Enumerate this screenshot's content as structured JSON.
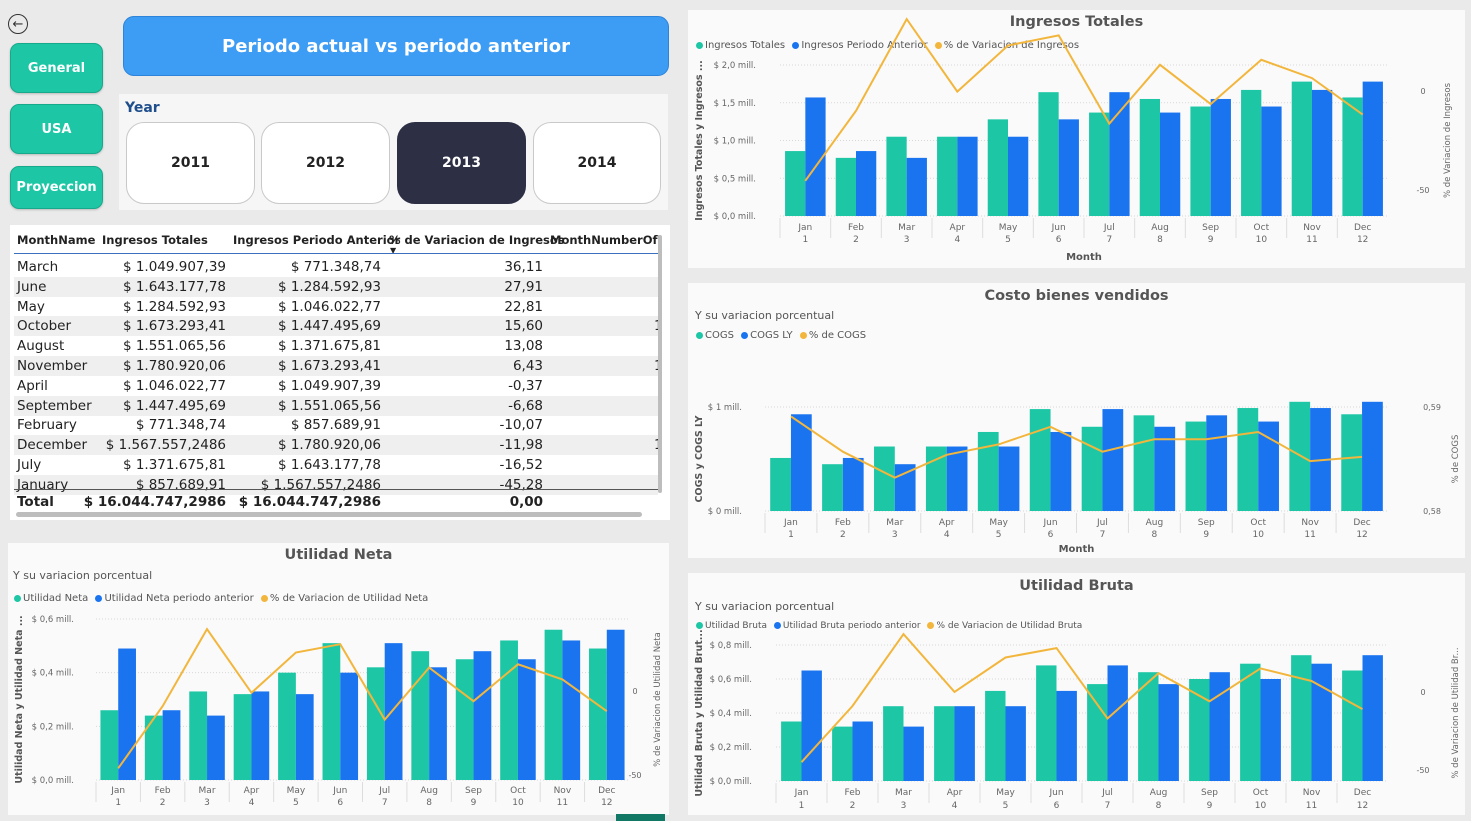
{
  "nav": {
    "back_icon": "arrow-left-circle-icon",
    "general": "General",
    "usa": "USA",
    "proyeccion": "Proyeccion"
  },
  "banner": {
    "title": "Periodo actual vs periodo anterior"
  },
  "year_slicer": {
    "title": "Year",
    "options": [
      "2011",
      "2012",
      "2013",
      "2014"
    ],
    "selected": "2013"
  },
  "table": {
    "headers": [
      "MonthName",
      "Ingresos Totales",
      "Ingresos Periodo Anterior",
      "% de Variacion de Ingresos",
      "MonthNumberOfYe"
    ],
    "rows": [
      [
        "March",
        "$ 1.049.907,39",
        "$ 771.348,74",
        "36,11",
        ""
      ],
      [
        "June",
        "$ 1.643.177,78",
        "$ 1.284.592,93",
        "27,91",
        ""
      ],
      [
        "May",
        "$ 1.284.592,93",
        "$ 1.046.022,77",
        "22,81",
        ""
      ],
      [
        "October",
        "$ 1.673.293,41",
        "$ 1.447.495,69",
        "15,60",
        "1"
      ],
      [
        "August",
        "$ 1.551.065,56",
        "$ 1.371.675,81",
        "13,08",
        ""
      ],
      [
        "November",
        "$ 1.780.920,06",
        "$ 1.673.293,41",
        "6,43",
        "1"
      ],
      [
        "April",
        "$ 1.046.022,77",
        "$ 1.049.907,39",
        "-0,37",
        ""
      ],
      [
        "September",
        "$ 1.447.495,69",
        "$ 1.551.065,56",
        "-6,68",
        ""
      ],
      [
        "February",
        "$ 771.348,74",
        "$ 857.689,91",
        "-10,07",
        ""
      ],
      [
        "December",
        "$ 1.567.557,2486",
        "$ 1.780.920,06",
        "-11,98",
        "1"
      ],
      [
        "July",
        "$ 1.371.675,81",
        "$ 1.643.177,78",
        "-16,52",
        ""
      ],
      [
        "January",
        "$ 857.689,91",
        "$ 1.567.557,2486",
        "-45,28",
        ""
      ]
    ],
    "total": [
      "Total",
      "$ 16.044.747,2986",
      "$ 16.044.747,2986",
      "0,00",
      ""
    ]
  },
  "colors": {
    "current": "#1dc7a6",
    "previous": "#1a74f0",
    "variation": "#f2b63c"
  },
  "chart_data": [
    {
      "id": "ingresos",
      "type": "bar",
      "title": "Ingresos Totales",
      "subtitle": "",
      "legend": [
        "Ingresos Totales",
        "Ingresos Periodo Anterior",
        "% de Variacion de Ingresos"
      ],
      "categories": [
        "Jan",
        "Feb",
        "Mar",
        "Apr",
        "May",
        "Jun",
        "Jul",
        "Aug",
        "Sep",
        "Oct",
        "Nov",
        "Dec"
      ],
      "category_numbers": [
        "1",
        "2",
        "3",
        "4",
        "5",
        "6",
        "7",
        "8",
        "9",
        "10",
        "11",
        "12"
      ],
      "xlabel": "Month",
      "ylabel": "Ingresos Totales y Ingresos ...",
      "y2label": "% de Variacion de Ingresos",
      "yticks": [
        "$ 0,0 mill.",
        "$ 0,5 mill.",
        "$ 1,0 mill.",
        "$ 1,5 mill.",
        "$ 2,0 mill."
      ],
      "ylim": [
        0,
        2.0
      ],
      "y2ticks": [
        "-50",
        "0"
      ],
      "y2tick_values": [
        -50,
        0
      ],
      "y2lim": [
        -63,
        13
      ],
      "series": [
        {
          "name": "Ingresos Totales",
          "values": [
            0.86,
            0.77,
            1.05,
            1.05,
            1.28,
            1.64,
            1.37,
            1.55,
            1.45,
            1.67,
            1.78,
            1.57
          ]
        },
        {
          "name": "Ingresos Periodo Anterior",
          "values": [
            1.57,
            0.86,
            0.77,
            1.05,
            1.05,
            1.28,
            1.64,
            1.37,
            1.55,
            1.45,
            1.67,
            1.78
          ]
        },
        {
          "name": "% de Variacion de Ingresos",
          "values": [
            -45.28,
            -10.07,
            36.11,
            -0.37,
            22.81,
            27.91,
            -16.52,
            13.08,
            -6.68,
            15.6,
            6.43,
            -11.98
          ]
        }
      ]
    },
    {
      "id": "cogs",
      "type": "bar",
      "title": "Costo bienes vendidos",
      "subtitle": "Y su variacion porcentual",
      "legend": [
        "COGS",
        "COGS LY",
        "% de COGS"
      ],
      "categories": [
        "Jan",
        "Feb",
        "Mar",
        "Apr",
        "May",
        "Jun",
        "Jul",
        "Aug",
        "Sep",
        "Oct",
        "Nov",
        "Dec"
      ],
      "category_numbers": [
        "1",
        "2",
        "3",
        "4",
        "5",
        "6",
        "7",
        "8",
        "9",
        "10",
        "11",
        "12"
      ],
      "xlabel": "Month",
      "ylabel": "COGS y COGS LY",
      "y2label": "% de COGS",
      "yticks": [
        "$ 0 mill.",
        "$ 1 mill."
      ],
      "ylim": [
        0,
        1.0
      ],
      "y2ticks": [
        "0,58",
        "0,59"
      ],
      "y2tick_values": [
        0.58,
        0.59
      ],
      "y2lim": [
        0.58,
        0.59
      ],
      "series": [
        {
          "name": "COGS",
          "values": [
            0.51,
            0.45,
            0.62,
            0.62,
            0.76,
            0.98,
            0.81,
            0.92,
            0.86,
            0.99,
            1.05,
            0.93
          ]
        },
        {
          "name": "COGS LY",
          "values": [
            0.93,
            0.51,
            0.45,
            0.62,
            0.62,
            0.76,
            0.98,
            0.81,
            0.92,
            0.86,
            0.99,
            1.05
          ]
        },
        {
          "name": "% de COGS",
          "values": [
            0.5891,
            0.5857,
            0.5832,
            0.5854,
            0.5864,
            0.5881,
            0.5857,
            0.5869,
            0.5869,
            0.5876,
            0.5848,
            0.5852
          ]
        }
      ]
    },
    {
      "id": "utilidad_neta",
      "type": "bar",
      "title": "Utilidad Neta",
      "subtitle": "Y su variacion porcentual",
      "legend": [
        "Utilidad Neta",
        "Utilidad Neta periodo anterior",
        "% de Variacion de Utilidad Neta"
      ],
      "categories": [
        "Jan",
        "Feb",
        "Mar",
        "Apr",
        "May",
        "Jun",
        "Jul",
        "Aug",
        "Sep",
        "Oct",
        "Nov",
        "Dec"
      ],
      "category_numbers": [
        "1",
        "2",
        "3",
        "4",
        "5",
        "6",
        "7",
        "8",
        "9",
        "10",
        "11",
        "12"
      ],
      "xlabel": "",
      "ylabel": "Utilidad Neta y Utilidad Neta ...",
      "y2label": "% de Variacion de Utilidad Neta",
      "yticks": [
        "$ 0,0 mill.",
        "$ 0,2 mill.",
        "$ 0,4 mill.",
        "$ 0,6 mill."
      ],
      "ylim": [
        0,
        0.6
      ],
      "y2ticks": [
        "-50",
        "0"
      ],
      "y2tick_values": [
        -50,
        0
      ],
      "y2lim": [
        -53,
        43
      ],
      "series": [
        {
          "name": "Utilidad Neta",
          "values": [
            0.26,
            0.24,
            0.33,
            0.32,
            0.4,
            0.51,
            0.42,
            0.48,
            0.45,
            0.52,
            0.56,
            0.49
          ]
        },
        {
          "name": "Utilidad Neta periodo anterior",
          "values": [
            0.49,
            0.26,
            0.24,
            0.33,
            0.32,
            0.4,
            0.51,
            0.42,
            0.48,
            0.45,
            0.52,
            0.56
          ]
        },
        {
          "name": "% de Variacion de Utilidad Neta",
          "values": [
            -46,
            -9,
            37,
            -1,
            23,
            28,
            -17,
            14,
            -6,
            16,
            7,
            -12
          ]
        }
      ]
    },
    {
      "id": "utilidad_bruta",
      "type": "bar",
      "title": "Utilidad Bruta",
      "subtitle": "Y su variacion porcentual",
      "legend": [
        "Utilidad Bruta",
        "Utilidad Bruta periodo anterior",
        "% de Variacion de Utilidad Bruta"
      ],
      "categories": [
        "Jan",
        "Feb",
        "Mar",
        "Apr",
        "May",
        "Jun",
        "Jul",
        "Aug",
        "Sep",
        "Oct",
        "Nov",
        "Dec"
      ],
      "category_numbers": [
        "1",
        "2",
        "3",
        "4",
        "5",
        "6",
        "7",
        "8",
        "9",
        "10",
        "11",
        "12"
      ],
      "xlabel": "",
      "ylabel": "Utilidad Bruta y Utilidad Brut...",
      "y2label": "% de Variacion de Utilidad Br...",
      "yticks": [
        "$ 0,0 mill.",
        "$ 0,2 mill.",
        "$ 0,4 mill.",
        "$ 0,6 mill.",
        "$ 0,8 mill."
      ],
      "ylim": [
        0,
        0.8
      ],
      "y2ticks": [
        "-50",
        "0"
      ],
      "y2tick_values": [
        -50,
        0
      ],
      "y2lim": [
        -57,
        30
      ],
      "series": [
        {
          "name": "Utilidad Bruta",
          "values": [
            0.35,
            0.32,
            0.44,
            0.44,
            0.53,
            0.68,
            0.57,
            0.64,
            0.6,
            0.69,
            0.74,
            0.65
          ]
        },
        {
          "name": "Utilidad Bruta periodo anterior",
          "values": [
            0.65,
            0.35,
            0.32,
            0.44,
            0.44,
            0.53,
            0.68,
            0.57,
            0.64,
            0.6,
            0.69,
            0.74
          ]
        },
        {
          "name": "% de Variacion de Utilidad Bruta",
          "values": [
            -45,
            -9,
            37,
            0,
            22,
            28,
            -17,
            12,
            -6,
            15,
            7,
            -11
          ]
        }
      ]
    }
  ]
}
